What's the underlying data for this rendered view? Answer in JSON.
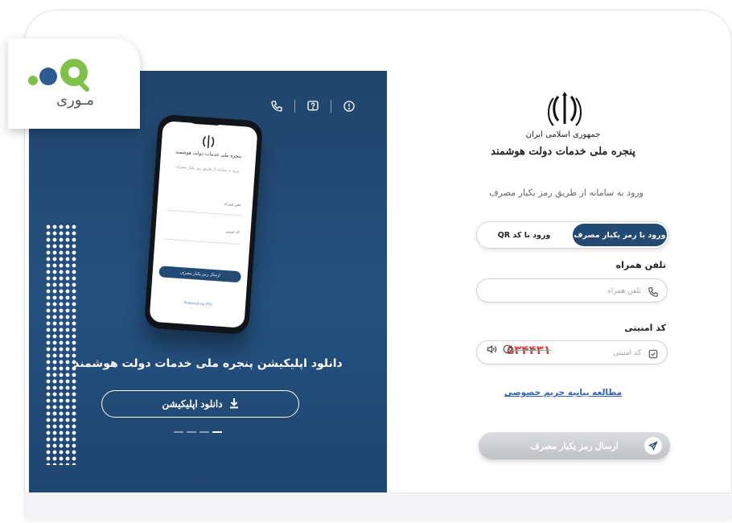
{
  "brand": {
    "text": "مـوری",
    "colors": {
      "primary": "#2e5a92",
      "accent": "#7fc24a"
    }
  },
  "left_panel": {
    "icons": [
      "phone-icon",
      "help-icon",
      "info-icon"
    ],
    "app_title": "دانلود اپلیکیشن پنجره ملی خدمات دولت هوشمند",
    "download_button": "دانلود اپلیکیشن",
    "pager_count": 4,
    "phone_mockup": {
      "title": "پنجره ملی خدمات دولت هوشمند",
      "subtitle": "ورود به سامانه از طریق رمز یکبار مصرف",
      "field_phone": "تلفن همراه",
      "field_code": "کد امنیتی",
      "button": "ارسال رمز یکبار مصرف",
      "footer": "Powered by ITO"
    }
  },
  "form": {
    "header_line1": "جمهوری اسلامی ایران",
    "header_line2": "پنجره ملی خدمات دولت هوشمند",
    "subtitle": "ورود به سامانه از طریق رمز یکبار مصرف",
    "tabs": [
      {
        "label": "ورود با رمز یکبار مصرف",
        "active": true
      },
      {
        "label": "ورود با کد QR",
        "active": false
      }
    ],
    "phone": {
      "label": "تلفن همراه",
      "placeholder": "تلفن همراه"
    },
    "security": {
      "label": "کد امنیتی",
      "placeholder": "کد امنیتی",
      "captcha": "۵۳۴۴۳۱"
    },
    "privacy_link": "مطالعه بیانیه حریم خصوصی",
    "submit": "ارسال رمز یکبار مصرف"
  }
}
